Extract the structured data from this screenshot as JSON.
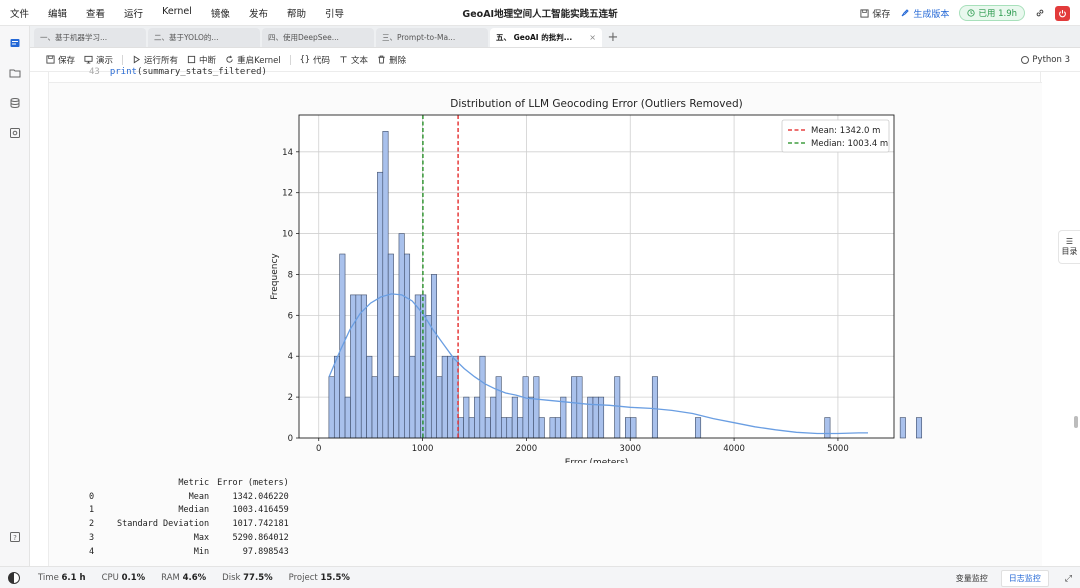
{
  "menubar": {
    "items": [
      "文件",
      "编辑",
      "查看",
      "运行",
      "Kernel",
      "镜像",
      "发布",
      "帮助",
      "引导"
    ],
    "title": "GeoAI地理空间人工智能实践五连斩",
    "save_label": "保存",
    "generate_label": "生成版本",
    "usage_label": "已用 1.9h"
  },
  "tabs": [
    {
      "label": "一、基于机器学习..."
    },
    {
      "label": "二、基于YOLO的..."
    },
    {
      "label": "四、使用DeepSee..."
    },
    {
      "label": "三、Prompt-to-Ma..."
    },
    {
      "label": "五、 GeoAI 的批判..."
    }
  ],
  "toolbar": {
    "save": "保存",
    "present": "演示",
    "run_all": "运行所有",
    "interrupt": "中断",
    "restart": "重启Kernel",
    "code": "代码",
    "text": "文本",
    "delete": "删除",
    "kernel": "Python 3"
  },
  "code": {
    "line_number": "43",
    "fn": "print",
    "args": "(summary_stats_filtered)"
  },
  "outline": {
    "label": "目录"
  },
  "chart_data": {
    "type": "bar",
    "title": "Distribution of LLM Geocoding Error (Outliers Removed)",
    "xlabel": "Error (meters)",
    "ylabel": "Frequency",
    "xlim": [
      -190,
      5540
    ],
    "ylim": [
      0,
      15.8
    ],
    "xticks": [
      0,
      1000,
      2000,
      3000,
      4000,
      5000
    ],
    "xtick_labels": [
      "0",
      "1000",
      "2000",
      "3000",
      "4000",
      "5000"
    ],
    "yticks": [
      0,
      2,
      4,
      6,
      8,
      10,
      12,
      14
    ],
    "ytick_labels": [
      "0",
      "2",
      "4",
      "6",
      "8",
      "10",
      "12",
      "14"
    ],
    "grid": true,
    "legend_position": "top-right",
    "bin_start": 97.9,
    "bin_width": 51.9,
    "counts": [
      3,
      4,
      9,
      2,
      7,
      7,
      7,
      4,
      3,
      13,
      15,
      9,
      3,
      10,
      9,
      4,
      7,
      7,
      6,
      8,
      3,
      4,
      4,
      4,
      1,
      2,
      1,
      2,
      4,
      1,
      2,
      3,
      1,
      1,
      2,
      1,
      3,
      2,
      3,
      1,
      0,
      1,
      1,
      2,
      0,
      3,
      3,
      0,
      2,
      2,
      2,
      0,
      0,
      3,
      0,
      1,
      1,
      0,
      0,
      0,
      3,
      0,
      0,
      0,
      0,
      0,
      0,
      0,
      1,
      0,
      0,
      0,
      0,
      0,
      0,
      0,
      0,
      0,
      0,
      0,
      0,
      0,
      0,
      0,
      0,
      0,
      0,
      0,
      0,
      0,
      0,
      0,
      1,
      0,
      0,
      0,
      0,
      0,
      0,
      0,
      0,
      0,
      0,
      0,
      0,
      0,
      1,
      0,
      0,
      1
    ],
    "kde": [
      [
        100,
        3.0
      ],
      [
        200,
        4.2
      ],
      [
        300,
        5.3
      ],
      [
        400,
        6.1
      ],
      [
        500,
        6.6
      ],
      [
        600,
        6.9
      ],
      [
        700,
        7.05
      ],
      [
        800,
        7.0
      ],
      [
        900,
        6.7
      ],
      [
        1000,
        6.1
      ],
      [
        1100,
        5.3
      ],
      [
        1200,
        4.6
      ],
      [
        1300,
        3.9
      ],
      [
        1400,
        3.4
      ],
      [
        1500,
        3.0
      ],
      [
        1600,
        2.65
      ],
      [
        1700,
        2.4
      ],
      [
        1800,
        2.2
      ],
      [
        1900,
        2.1
      ],
      [
        2000,
        1.95
      ],
      [
        2200,
        1.85
      ],
      [
        2400,
        1.75
      ],
      [
        2600,
        1.65
      ],
      [
        2800,
        1.6
      ],
      [
        3000,
        1.5
      ],
      [
        3200,
        1.45
      ],
      [
        3400,
        1.35
      ],
      [
        3600,
        1.2
      ],
      [
        3800,
        0.95
      ],
      [
        4000,
        0.75
      ],
      [
        4200,
        0.55
      ],
      [
        4400,
        0.4
      ],
      [
        4600,
        0.28
      ],
      [
        4800,
        0.22
      ],
      [
        5000,
        0.22
      ],
      [
        5200,
        0.25
      ],
      [
        5290,
        0.25
      ]
    ],
    "lines": [
      {
        "name": "Mean: 1342.0 m",
        "x": 1342.0,
        "color": "#e21b1b"
      },
      {
        "name": "Median: 1003.4 m",
        "x": 1003.4,
        "color": "#1a8a1a"
      }
    ],
    "bar_color": "#a9c1ec",
    "bar_edge": "#3c4a66",
    "kde_color": "#6a9ee2"
  },
  "stats_table": {
    "headers": [
      "Metric",
      "Error (meters)"
    ],
    "rows": [
      {
        "index": "0",
        "metric": "Mean",
        "value": "1342.046220"
      },
      {
        "index": "1",
        "metric": "Median",
        "value": "1003.416459"
      },
      {
        "index": "2",
        "metric": "Standard Deviation",
        "value": "1017.742181"
      },
      {
        "index": "3",
        "metric": "Max",
        "value": "5290.864012"
      },
      {
        "index": "4",
        "metric": "Min",
        "value": "97.898543"
      }
    ]
  },
  "statusbar": {
    "time_label": "Time",
    "time_value": "6.1 h",
    "cpu_label": "CPU",
    "cpu_value": "0.1%",
    "ram_label": "RAM",
    "ram_value": "4.6%",
    "disk_label": "Disk",
    "disk_value": "77.5%",
    "project_label": "Project",
    "project_value": "15.5%",
    "var_monitor": "变量监控",
    "log_monitor": "日志监控"
  }
}
